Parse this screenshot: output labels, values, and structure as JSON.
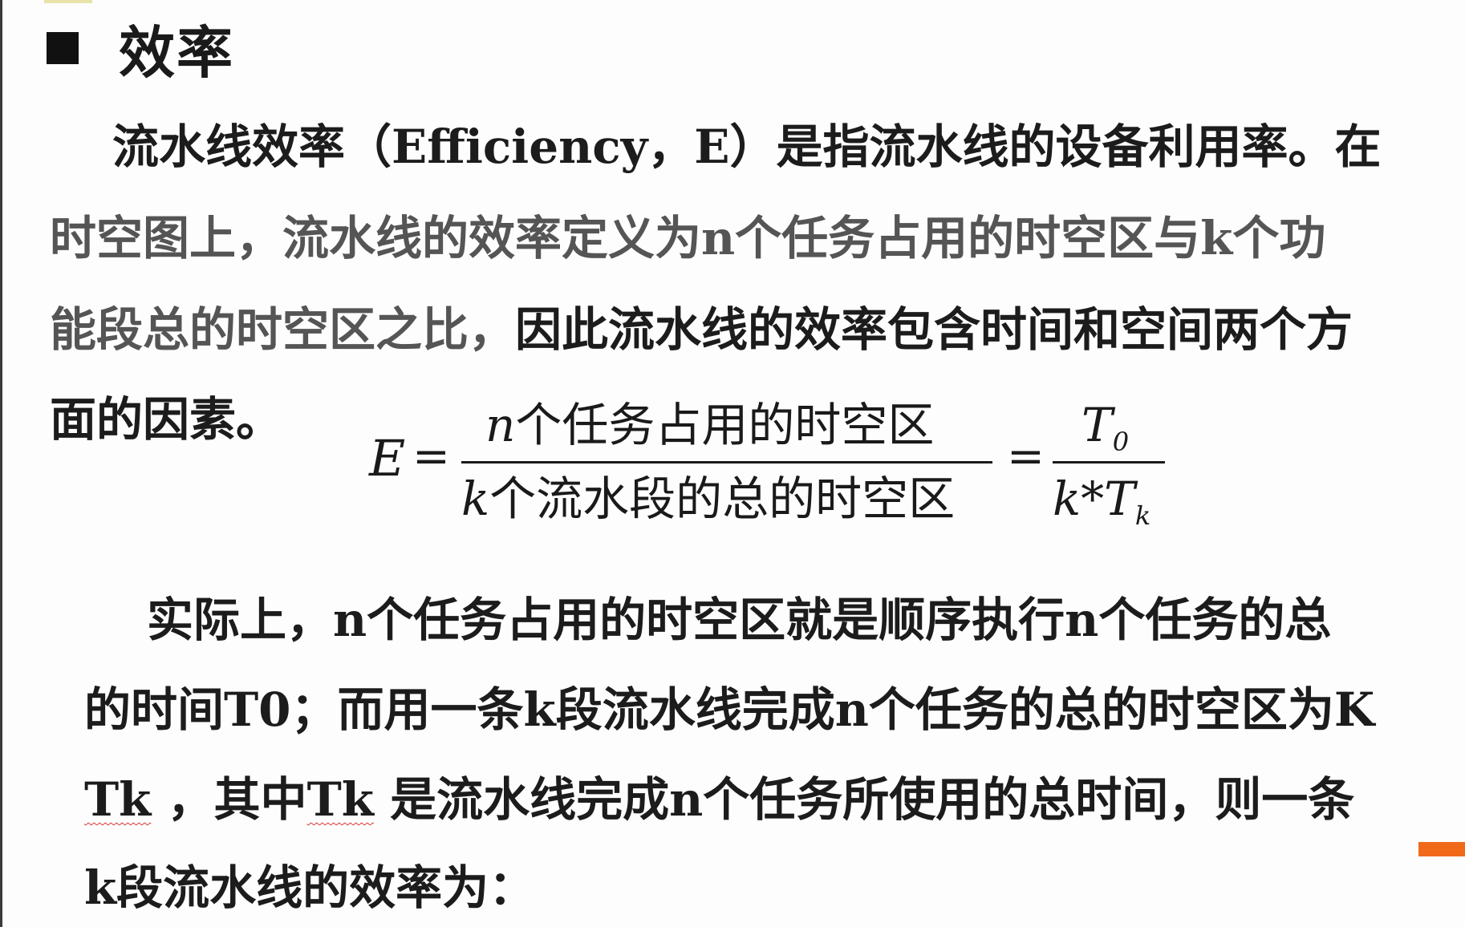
{
  "slide": {
    "title": "效率"
  },
  "paragraph1": {
    "line1": "流水线效率（Efficiency，E）是指流水线的设备利用率。在",
    "line2": "时空图上，流水线的效率定义为n个任务占用的时空区与k个功",
    "line3a": "能段总的时空区之比，",
    "line3b": "因此流水线的效率包含时间和空间两个方",
    "line4": "面的因素。"
  },
  "formula": {
    "lhs": "E",
    "equals": "=",
    "numerator_var": "n",
    "numerator_text": "个任务占用的时空区",
    "denominator_var": "k",
    "denominator_text": "个流水段的总的时空区",
    "rhs_numerator_var": "T",
    "rhs_numerator_sub": "0",
    "rhs_denominator_var1": "k",
    "rhs_denominator_op": "*",
    "rhs_denominator_var2": "T",
    "rhs_denominator_sub": "k"
  },
  "paragraph2": {
    "line1": "实际上，n个任务占用的时空区就是顺序执行n个任务的总",
    "line2": "的时间T0；而用一条k段流水线完成n个任务的总的时空区为K",
    "line3_tk1": "Tk",
    "line3_sep": " ，其中",
    "line3_tk2": "Tk",
    "line3_rest": " 是流水线完成n个任务所使用的总时间，则一条",
    "line4": "k段流水线的效率为："
  },
  "colors": {
    "accent_bar": "#f06a1a",
    "text_dark": "#1c1c1c",
    "text_muted": "#555555"
  }
}
